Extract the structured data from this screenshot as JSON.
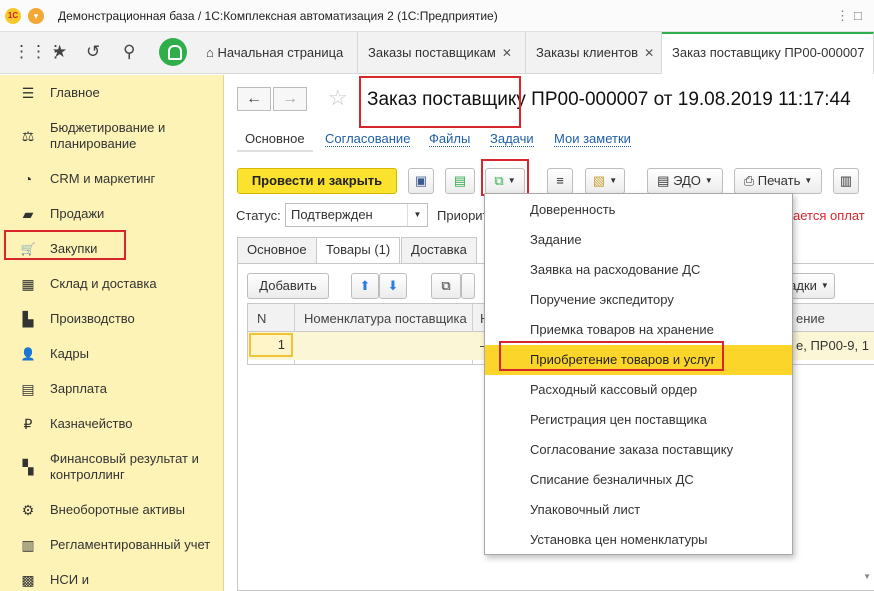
{
  "window": {
    "logo": "1С",
    "title": "Демонстрационная база / 1С:Комплексная автоматизация 2  (1С:Предприятие)",
    "controls": [
      "⋮",
      "□"
    ]
  },
  "tabs": [
    {
      "label": "Начальная страница",
      "close": ""
    },
    {
      "label": "Заказы поставщикам",
      "close": "✕"
    },
    {
      "label": "Заказы клиентов",
      "close": "✕"
    },
    {
      "label": "Заказ поставщику ПР00-000007",
      "close": ""
    }
  ],
  "sidebar": {
    "items": [
      {
        "icon": "hamburger-icon",
        "glyph": "☰",
        "label": "Главное"
      },
      {
        "icon": "budget-icon",
        "glyph": "⚖",
        "label": "Бюджетирование и\nпланирование"
      },
      {
        "icon": "crm-icon",
        "glyph": "◔",
        "label": "CRM и маркетинг"
      },
      {
        "icon": "sales-icon",
        "glyph": "▰",
        "label": "Продажи"
      },
      {
        "icon": "cart-icon",
        "glyph": "🛒",
        "label": "Закупки"
      },
      {
        "icon": "warehouse-icon",
        "glyph": "▦",
        "label": "Склад и доставка"
      },
      {
        "icon": "factory-icon",
        "glyph": "▙",
        "label": "Производство"
      },
      {
        "icon": "people-icon",
        "glyph": "👤",
        "label": "Кадры"
      },
      {
        "icon": "salary-icon",
        "glyph": "▤",
        "label": "Зарплата"
      },
      {
        "icon": "treasury-icon",
        "glyph": "₽",
        "label": "Казначейство"
      },
      {
        "icon": "finance-icon",
        "glyph": "▚",
        "label": "Финансовый результат и\nконтроллинг"
      },
      {
        "icon": "assets-icon",
        "glyph": "⚙",
        "label": "Внеоборотные активы"
      },
      {
        "icon": "accounting-icon",
        "glyph": "▥",
        "label": "Регламентированный учет"
      },
      {
        "icon": "nsi-icon",
        "glyph": "▩",
        "label": "НСИ и"
      }
    ]
  },
  "document": {
    "title": "Заказ поставщику ПР00-000007 от 19.08.2019 11:17:44",
    "sections": [
      "Основное",
      "Согласование",
      "Файлы",
      "Задачи",
      "Мои заметки"
    ]
  },
  "toolbar": {
    "post_close": "Провести и закрыть",
    "edo": "ЭДО",
    "print": "Печать"
  },
  "status": {
    "label": "Статус:",
    "value": "Подтвержден",
    "priority_label": "Приорит",
    "payment_link": "ается оплат"
  },
  "form_tabs": [
    "Основное",
    "Товары (1)",
    "Доставка"
  ],
  "table": {
    "add_button": "Добавить",
    "right_button": "адки",
    "columns": [
      "N",
      "Номенклатура поставщика",
      "Н",
      "ение"
    ],
    "rows": [
      {
        "n": "1",
        "right_cell": "е, ПР00-9, 1"
      }
    ]
  },
  "menu": {
    "items": [
      "Доверенность",
      "Задание",
      "Заявка на расходование ДС",
      "Поручение экспедитору",
      "Приемка товаров на хранение",
      "Приобретение товаров и услуг",
      "Расходный кассовый ордер",
      "Регистрация цен поставщика",
      "Согласование заказа поставщику",
      "Списание безналичных ДС",
      "Упаковочный лист",
      "Установка цен номенклатуры"
    ],
    "selected": "Приобретение товаров и услуг"
  },
  "colors": {
    "sidebar_bg": "#fdf3b7",
    "highlight": "#fcd52a",
    "annotation_red": "#d9262d",
    "primary_button": "#fbe22f",
    "link": "#1e5fa9"
  }
}
